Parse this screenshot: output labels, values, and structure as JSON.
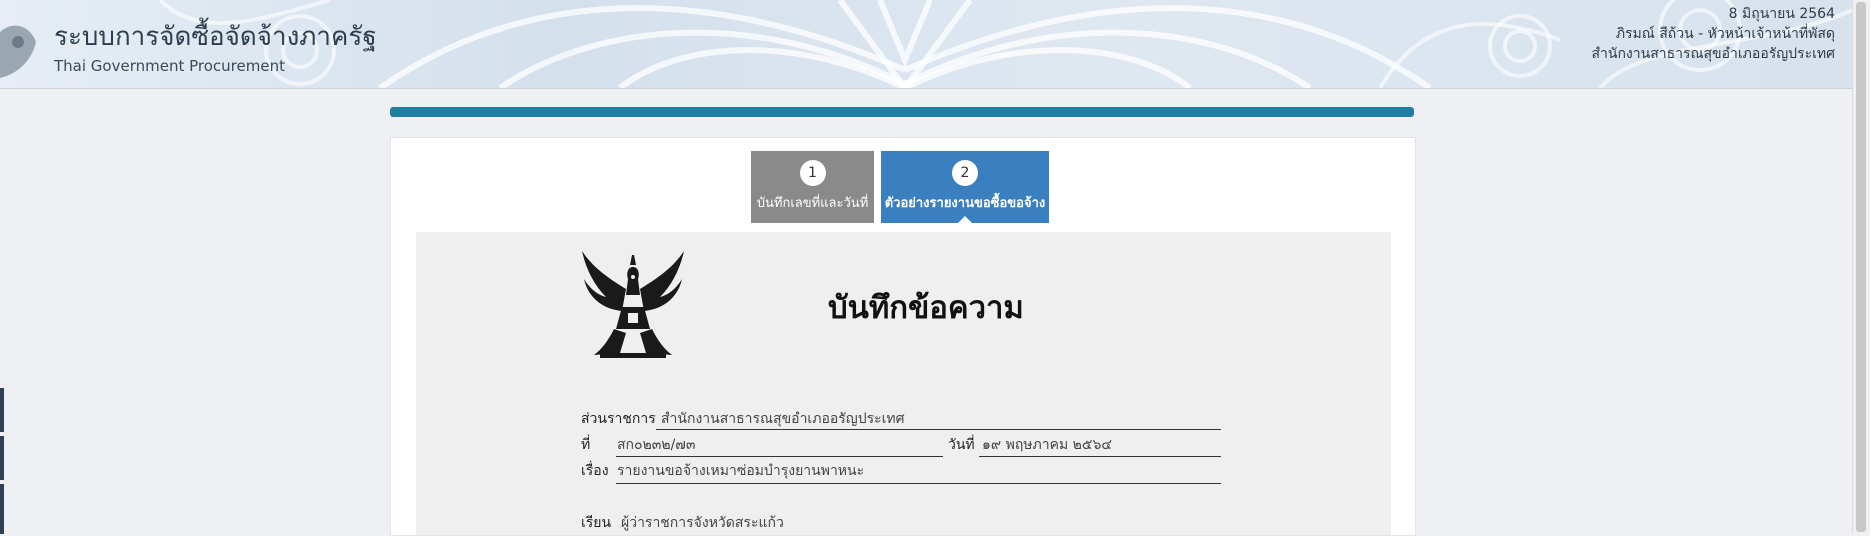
{
  "header": {
    "title_th": "ระบบการจัดซื้อจัดจ้างภาครัฐ",
    "title_en": "Thai Government Procurement",
    "date": "8 มิถุนายน 2564",
    "user": "ภิรมณ์ สีถ้วน - หัวหน้าเจ้าหน้าที่พัสดุ",
    "office": "สำนักงานสาธารณสุขอำเภออรัญประเทศ"
  },
  "progress": {
    "percent": 100
  },
  "steps": [
    {
      "number": "1",
      "label": "บันทึกเลขที่และวันที่"
    },
    {
      "number": "2",
      "label": "ตัวอย่างรายงานขอซื้อขอจ้าง"
    }
  ],
  "document": {
    "title": "บันทึกข้อความ",
    "agency_label": "ส่วนราชการ",
    "agency_value": "สำนักงานสาธารณสุขอำเภออรัญประเทศ",
    "ref_label": "ที่",
    "ref_value": "สก๐๒๓๒/๗๓",
    "date_label": "วันที่",
    "date_value": "๑๙ พฤษภาคม ๒๕๖๔",
    "subject_label": "เรื่อง",
    "subject_value": "รายงานขอจ้างเหมาซ่อมบำรุงยานพาหนะ",
    "to_label": "เรียน",
    "to_value": "ผู้ว่าราชการจังหวัดสระแก้ว"
  },
  "colors": {
    "progress": "#1f7fa3",
    "step_active": "#3a7fc0",
    "step_done": "#8a8a8a"
  }
}
